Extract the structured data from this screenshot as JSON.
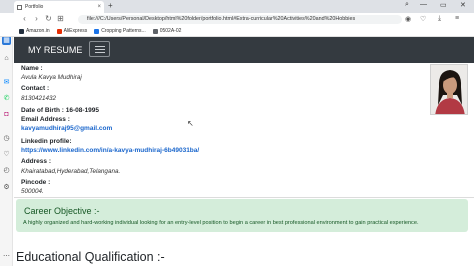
{
  "browser": {
    "tab_title": "Portfolio",
    "tab_close": "×",
    "new_tab": "+",
    "url": "file:///C:/Users/Personal/Desktop/html%20folder/portfolio.html#Extra-curricular%20Activities%20and%20Hobbies",
    "bookmarks": [
      "Amazon.in",
      "AliExpress",
      "Cropping Patterns...",
      "0502A-02"
    ],
    "bookmark_colors": [
      "#232f3e",
      "#e62e04",
      "#1a73e8",
      "#5f6368"
    ]
  },
  "navbar": {
    "brand": "MY RESUME"
  },
  "info": {
    "name_label": "Name :",
    "name_value": "Avula Kavya Mudhiraj",
    "contact_label": "Contact :",
    "contact_value": "8130421432",
    "dob_label": "Date of Birth : 16-08-1995",
    "email_label": "Email Address :",
    "email_value": "kavyamudhiraj95@gmail.com",
    "linkedin_label": "Linkedin profile:",
    "linkedin_value": "https://www.linkedin.com/in/a-kavya-mudhiraj-6b49031ba/",
    "address_label": "Address :",
    "address_value": "Khairatabad,Hyderabad,Telangana.",
    "pincode_label": "Pincode :",
    "pincode_value": "500004."
  },
  "career": {
    "title": "Career Objective :-",
    "text": "A highly organized and hard-working individual looking for an entry-level position to begin a career in best professional environment to gain practical experience."
  },
  "education": {
    "title": "Educational Qualification :-"
  },
  "colors": {
    "navbar_bg": "#343a40",
    "career_bg": "#d4edda",
    "career_text": "#155724",
    "link": "#1a66cc"
  }
}
